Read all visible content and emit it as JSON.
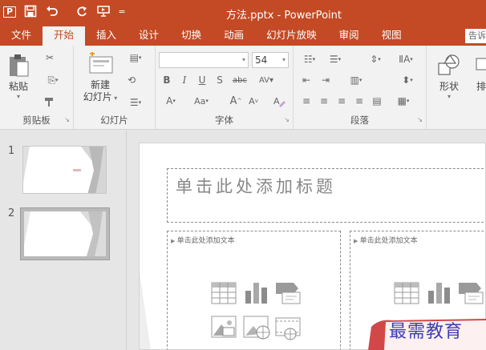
{
  "app": {
    "doc_title": "方法.pptx - PowerPoint"
  },
  "qat": {
    "app_badge": "P",
    "save_icon": "save-icon",
    "undo_icon": "undo-icon",
    "redo_icon": "redo-icon",
    "present_icon": "present-from-start-icon",
    "customize_icon": "customize-qat-icon"
  },
  "tabs": [
    {
      "label": "文件"
    },
    {
      "label": "开始"
    },
    {
      "label": "插入"
    },
    {
      "label": "设计"
    },
    {
      "label": "切换"
    },
    {
      "label": "动画"
    },
    {
      "label": "幻灯片放映"
    },
    {
      "label": "审阅"
    },
    {
      "label": "视图"
    }
  ],
  "tell_me": "告诉",
  "ribbon": {
    "clipboard": {
      "label": "剪贴板",
      "paste": "粘贴"
    },
    "slides": {
      "label": "幻灯片",
      "new_slide_line1": "新建",
      "new_slide_line2": "幻灯片"
    },
    "font": {
      "label": "字体",
      "font_name": "",
      "font_size": "54"
    },
    "paragraph": {
      "label": "段落"
    },
    "drawing": {
      "shapes": "形状",
      "arrange": "排"
    }
  },
  "slides_pane": {
    "slides": [
      {
        "number": "1"
      },
      {
        "number": "2"
      }
    ]
  },
  "slide": {
    "title_placeholder": "单击此处添加标题",
    "content_left": "单击此处添加文本",
    "content_right": "单击此处添加文本"
  },
  "watermark": "最需教育",
  "colors": {
    "accent": "#c34a25",
    "ribbon_bg": "#f2f2f2",
    "workspace_bg": "#e6e6e6",
    "watermark_text": "#3f3db3"
  }
}
